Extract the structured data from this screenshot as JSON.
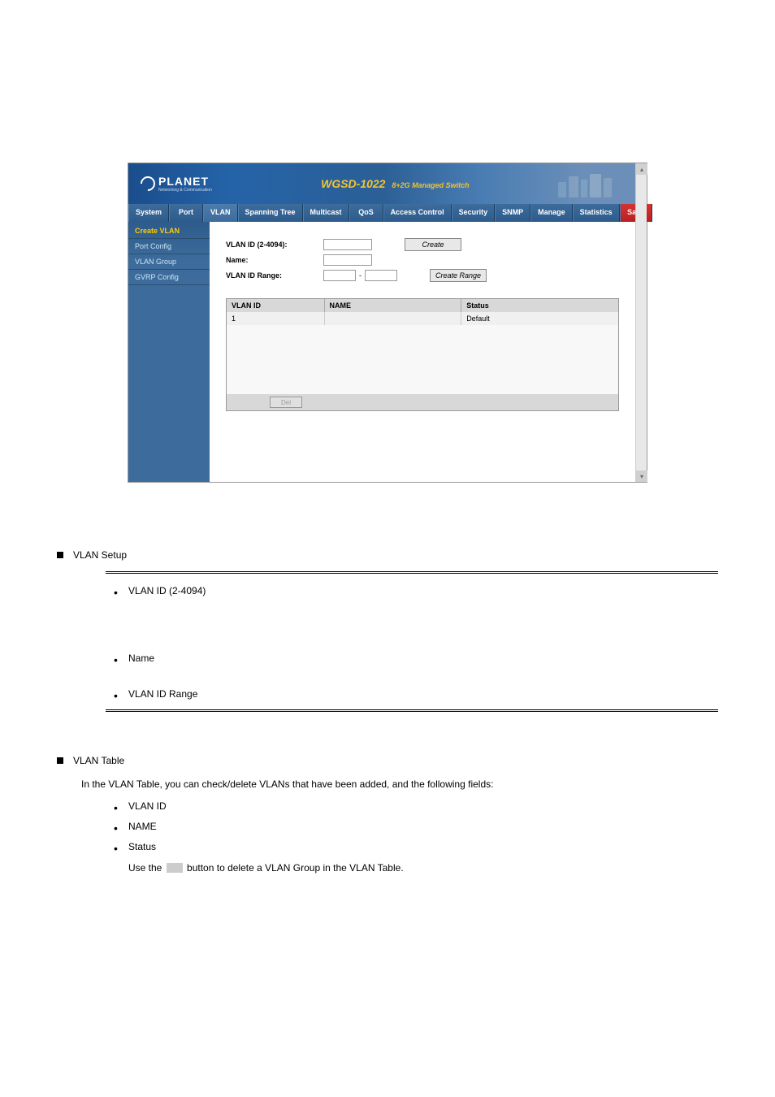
{
  "banner": {
    "logo_text": "PLANET",
    "logo_sub": "Networking & Communication",
    "product_title": "WGSD-1022",
    "product_sub": "8+2G Managed Switch"
  },
  "navbar": {
    "items": [
      "System",
      "Port",
      "VLAN",
      "Spanning Tree",
      "Multicast",
      "QoS",
      "Access Control",
      "Security",
      "SNMP",
      "Manage",
      "Statistics"
    ],
    "save": "Save"
  },
  "sidebar": {
    "items": [
      "Create VLAN",
      "Port Config",
      "VLAN Group",
      "GVRP Config"
    ]
  },
  "form": {
    "vlan_id_label": "VLAN ID (2-4094):",
    "name_label": "Name:",
    "vlan_range_label": "VLAN ID Range:",
    "create_btn": "Create",
    "create_range_btn": "Create Range",
    "range_dash": "-"
  },
  "table": {
    "headers": {
      "vlanid": "VLAN ID",
      "name": "NAME",
      "status": "Status"
    },
    "rows": [
      {
        "vlanid": "1",
        "name": "",
        "status": "Default"
      }
    ],
    "del_btn": "Del"
  },
  "doc": {
    "section1_title": "VLAN Setup",
    "item1_title": "VLAN ID (2-4094)",
    "item2_title": "Name",
    "item3_title": "VLAN ID Range",
    "section2_title": "VLAN Table",
    "section2_desc": "In the VLAN Table, you can check/delete VLANs that have been added, and the following fields:",
    "tbl_item1": "VLAN ID",
    "tbl_item2": "NAME",
    "tbl_item3": "Status",
    "del_hint": "Use the    button to delete a VLAN Group in the VLAN Table."
  }
}
